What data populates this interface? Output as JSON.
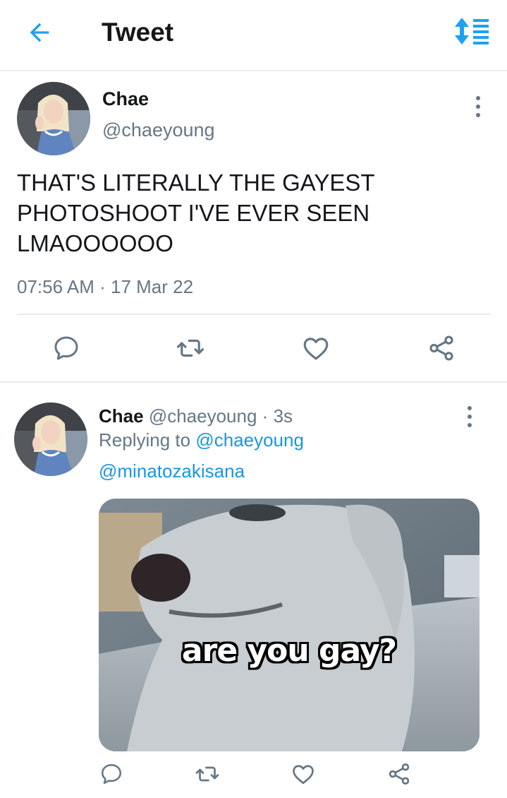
{
  "header": {
    "title": "Tweet",
    "back_icon": "arrow-left-icon",
    "sort_icon": "sort-arrows-icon",
    "accent": "#1da1f2"
  },
  "main_tweet": {
    "name": "Chae",
    "handle": "@chaeyoung",
    "text": "THAT'S LITERALLY THE GAYEST PHOTOSHOOT I'VE EVER SEEN LMAOOOOOO",
    "time": "07:56 AM",
    "separator": "·",
    "date": "17 Mar 22"
  },
  "reply_tweet": {
    "name": "Chae",
    "handle": "@chaeyoung",
    "dot": "·",
    "age": "3s",
    "replying_prefix": "Replying to",
    "replying_to": "@chaeyoung",
    "mention": "@minatozakisana",
    "media_caption": "are you gay?"
  },
  "actions": {
    "reply_icon": "reply-bubble-icon",
    "retweet_icon": "retweet-icon",
    "like_icon": "heart-icon",
    "share_icon": "share-icon",
    "icon_color": "#657786"
  },
  "colors": {
    "link": "#1b95e0",
    "muted": "#657786",
    "divider": "#e6ecf0"
  }
}
